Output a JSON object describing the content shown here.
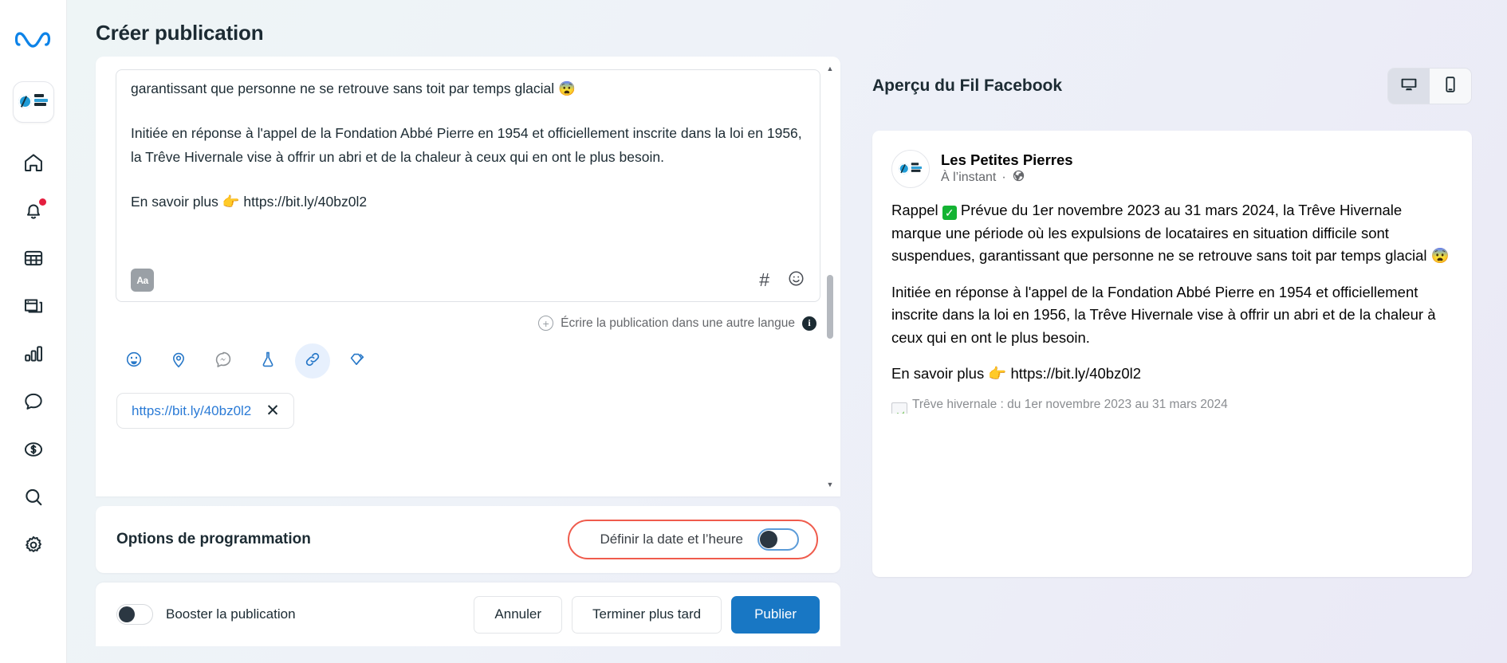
{
  "rail": {
    "meta_logo": "meta-logo",
    "brand": "les-petites-pierres-logo",
    "items": [
      {
        "name": "home-icon",
        "label": "Accueil",
        "badge": false
      },
      {
        "name": "notifications-bell-icon",
        "label": "Notifications",
        "badge": true
      },
      {
        "name": "table-grid-icon",
        "label": "Planning",
        "badge": false
      },
      {
        "name": "posts-stack-icon",
        "label": "Publications",
        "badge": false
      },
      {
        "name": "bar-chart-icon",
        "label": "Statistiques",
        "badge": false
      },
      {
        "name": "chat-bubble-icon",
        "label": "Messages",
        "badge": false
      },
      {
        "name": "dollar-circle-icon",
        "label": "Monétisation",
        "badge": false
      },
      {
        "name": "search-icon",
        "label": "Rechercher",
        "badge": false
      },
      {
        "name": "gear-icon",
        "label": "Paramètres",
        "badge": false
      }
    ]
  },
  "header": {
    "title": "Créer publication"
  },
  "composer": {
    "paragraphs": [
      "garantissant que personne ne se retrouve sans toit par temps glacial 😨",
      "Initiée en réponse à l'appel de la Fondation Abbé Pierre en 1954 et officiellement inscrite dans la loi en 1956, la Trêve Hivernale vise à offrir un abri et de la chaleur à ceux qui en ont le plus besoin.",
      "En savoir plus 👉 https://bit.ly/40bz0l2"
    ],
    "format_chip": "Aa",
    "hashtag_icon": "#",
    "emoji_icon": "☺",
    "other_language_label": "Écrire la publication dans une autre langue",
    "other_language_plus": "+",
    "info_badge": "i",
    "attachments": [
      {
        "name": "emoji-icon",
        "label": "Émoji",
        "active": false
      },
      {
        "name": "location-pin-icon",
        "label": "Lieu",
        "active": false
      },
      {
        "name": "messenger-icon",
        "label": "Messenger",
        "active": false
      },
      {
        "name": "flask-icon",
        "label": "Test A/B",
        "active": false
      },
      {
        "name": "link-icon",
        "label": "Lien",
        "active": true
      },
      {
        "name": "offer-diamond-icon",
        "label": "Offre",
        "active": false
      }
    ],
    "link_chip": {
      "url": "https://bit.ly/40bz0l2",
      "remove_label": "✕"
    }
  },
  "scheduling": {
    "title": "Options de programmation",
    "toggle_label": "Définir la date et l’heure",
    "toggle_on": false,
    "highlight_color": "#ef5b4c"
  },
  "footer": {
    "boost_label": "Booster la publication",
    "boost_on": false,
    "cancel_label": "Annuler",
    "finish_later_label": "Terminer plus tard",
    "publish_label": "Publier",
    "publish_color": "#1877c4"
  },
  "preview": {
    "title": "Aperçu du Fil Facebook",
    "devices": [
      {
        "name": "desktop-icon",
        "label": "Ordinateur",
        "active": true
      },
      {
        "name": "mobile-icon",
        "label": "Mobile",
        "active": false
      }
    ],
    "post": {
      "page_name": "Les Petites Pierres",
      "timestamp": "À l’instant",
      "separator": "·",
      "audience_icon": "🌐",
      "paragraph_1_prefix": "Rappel ",
      "paragraph_1_check": "✓",
      "paragraph_1_rest": " Prévue du 1er novembre 2023 au 31 mars 2024, la Trêve Hivernale marque une période où les expulsions de locataires en situation difficile sont suspendues, garantissant que personne ne se retrouve sans toit par temps glacial 😨",
      "paragraph_2": "Initiée en réponse à l'appel de la Fondation Abbé Pierre en 1954 et officiellement inscrite dans la loi en 1956, la Trêve Hivernale vise à offrir un abri et de la chaleur à ceux qui en ont le plus besoin.",
      "paragraph_3": "En savoir plus 👉 https://bit.ly/40bz0l2",
      "image_alt": "Trêve hivernale : du 1er novembre 2023 au 31 mars 2024"
    }
  }
}
